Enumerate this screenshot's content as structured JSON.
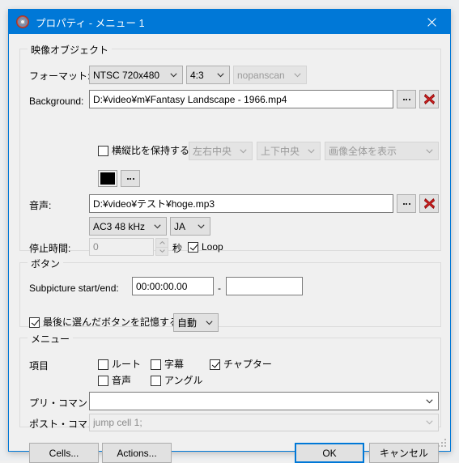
{
  "window": {
    "title": "プロパティ - メニュー 1",
    "icon": "disc-icon",
    "close_label": "×",
    "accent_color": "#0078d7"
  },
  "video_group": {
    "legend": "映像オブジェクト",
    "format_label": "フォーマット:",
    "format_value": "NTSC 720x480",
    "aspect_value": "4:3",
    "panscan_value": "nopanscan",
    "background_label": "Background:",
    "background_value": "D:¥video¥m¥Fantasy Landscape - 1966.mp4",
    "browse_label": "...",
    "clear_label": "✖",
    "keep_aspect_label": "横縦比を保持する",
    "keep_aspect_checked": false,
    "halign_value": "左右中央",
    "valign_value": "上下中央",
    "fit_value": "画像全体を表示",
    "color_swatch": "#000000",
    "color_browse_label": "..."
  },
  "audio_group": {
    "audio_label": "音声:",
    "audio_value": "D:¥video¥テスト¥hoge.mp3",
    "browse_label": "...",
    "clear_label": "✖",
    "codec_value": "AC3 48 kHz",
    "lang_value": "JA",
    "pause_label": "停止時間:",
    "pause_value": "0",
    "pause_unit": "秒",
    "loop_label": "Loop",
    "loop_checked": true
  },
  "button_group": {
    "legend": "ボタン",
    "subpicture_label": "Subpicture start/end:",
    "subpicture_start": "00:00:00.00",
    "subpicture_separator": "-",
    "subpicture_end": "",
    "remember_label": "最後に選んだボタンを記憶する",
    "remember_checked": true,
    "remember_mode": "自動"
  },
  "menu_group": {
    "legend": "メニュー",
    "items_label": "項目",
    "items": [
      {
        "label": "ルート",
        "checked": false
      },
      {
        "label": "字幕",
        "checked": false
      },
      {
        "label": "チャプター",
        "checked": true
      },
      {
        "label": "音声",
        "checked": false
      },
      {
        "label": "アングル",
        "checked": false
      }
    ],
    "pre_command_label": "プリ・コマンド:",
    "pre_command_value": "",
    "post_command_label": "ポスト・コマンド:",
    "post_command_value": "jump cell 1;"
  },
  "footer": {
    "cells_label": "Cells...",
    "actions_label": "Actions...",
    "ok_label": "OK",
    "cancel_label": "キャンセル"
  }
}
